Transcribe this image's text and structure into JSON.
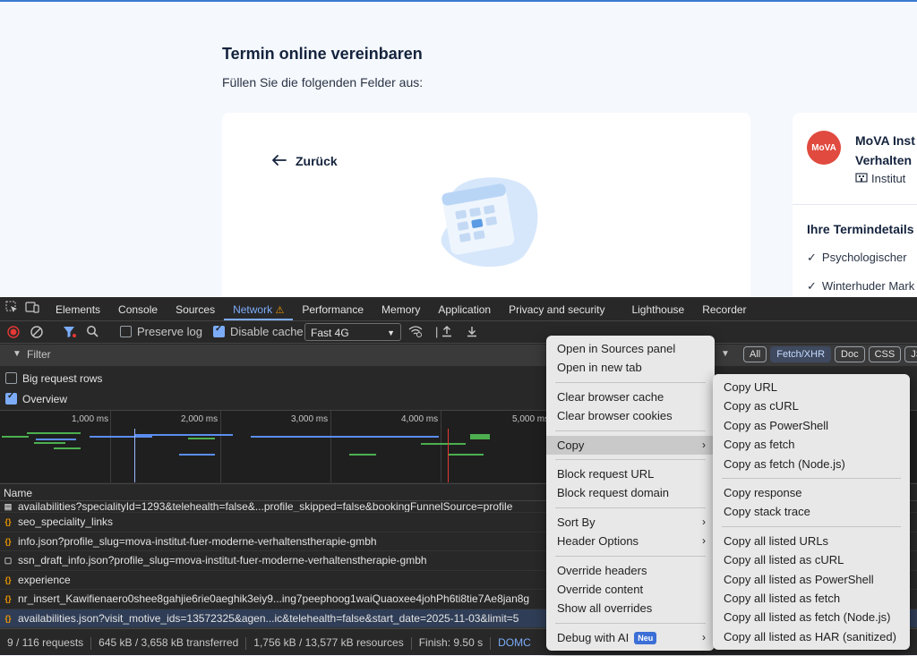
{
  "page": {
    "title": "Termin online vereinbaren",
    "subtitle": "Füllen Sie die folgenden Felder aus:",
    "back_label": "Zurück"
  },
  "sidebar": {
    "logo_text": "MoVA",
    "name_line1": "MoVA Inst",
    "name_line2": "Verhalten",
    "type": "Institut",
    "details_heading": "Ihre Termindetails",
    "details": [
      "Psychologischer",
      "Winterhuder Mark"
    ]
  },
  "devtools": {
    "tabs": [
      "Elements",
      "Console",
      "Sources",
      "Network",
      "Performance",
      "Memory",
      "Application",
      "Privacy and security",
      "Lighthouse",
      "Recorder"
    ],
    "active_tab": "Network",
    "toolbar": {
      "preserve_log": "Preserve log",
      "disable_cache": "Disable cache",
      "throttle": "Fast 4G"
    },
    "filter_placeholder": "Filter",
    "filter_chips": [
      "All",
      "Fetch/XHR",
      "Doc",
      "CSS",
      "JS"
    ],
    "options": {
      "big_rows": "Big request rows",
      "overview": "Overview"
    },
    "timeline_ticks": [
      "1,000 ms",
      "2,000 ms",
      "3,000 ms",
      "4,000 ms",
      "5,000 ms"
    ],
    "column_name": "Name",
    "requests": [
      "availabilities?specialityId=1293&telehealth=false&...profile_skipped=false&bookingFunnelSource=profile",
      "seo_speciality_links",
      "info.json?profile_slug=mova-institut-fuer-moderne-verhaltenstherapie-gmbh",
      "ssn_draft_info.json?profile_slug=mova-institut-fuer-moderne-verhaltenstherapie-gmbh",
      "experience",
      "nr_insert_Kawifienaero0shee8gahjie6rie0aeghik3eiy9...ing7peephoog1waiQuaoxee4johPh6ti8tie7Ae8jan8g",
      "availabilities.json?visit_motive_ids=13572325&agen...ic&telehealth=false&start_date=2025-11-03&limit=5"
    ],
    "status": {
      "requests": "9 / 116 requests",
      "transferred": "645 kB / 3,658 kB transferred",
      "resources": "1,756 kB / 13,577 kB resources",
      "finish": "Finish: 9.50 s",
      "domc": "DOMC"
    }
  },
  "context_menu": {
    "groups": [
      [
        "Open in Sources panel",
        "Open in new tab"
      ],
      [
        "Clear browser cache",
        "Clear browser cookies"
      ],
      [
        "Copy"
      ],
      [
        "Block request URL",
        "Block request domain"
      ],
      [
        "Sort By",
        "Header Options"
      ],
      [
        "Override headers",
        "Override content",
        "Show all overrides"
      ],
      [
        "Debug with AI"
      ]
    ],
    "debug_badge": "Neu"
  },
  "copy_submenu": {
    "groups": [
      [
        "Copy URL",
        "Copy as cURL",
        "Copy as PowerShell",
        "Copy as fetch",
        "Copy as fetch (Node.js)"
      ],
      [
        "Copy response",
        "Copy stack trace"
      ],
      [
        "Copy all listed URLs",
        "Copy all listed as cURL",
        "Copy all listed as PowerShell",
        "Copy all listed as fetch",
        "Copy all listed as fetch (Node.js)",
        "Copy all listed as HAR (sanitized)"
      ]
    ]
  },
  "colors": {
    "accent": "#7cacf8",
    "warning": "#f29900",
    "record": "#e53935",
    "logo": "#e04a3f"
  }
}
